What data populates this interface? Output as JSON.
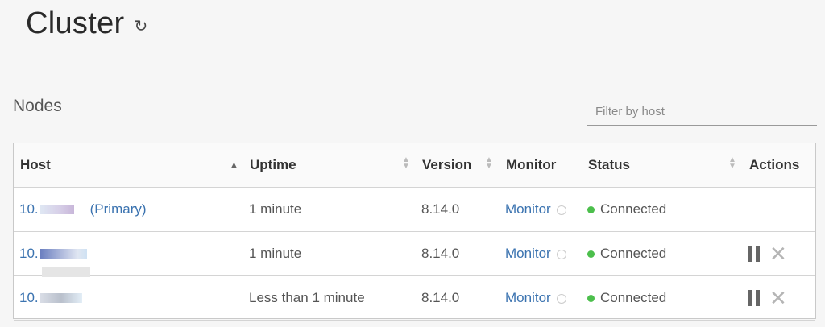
{
  "header": {
    "title": "Cluster",
    "refresh_icon": "↻"
  },
  "section": {
    "title": "Nodes"
  },
  "filter": {
    "placeholder": "Filter by host",
    "value": ""
  },
  "table": {
    "columns": {
      "host": "Host",
      "uptime": "Uptime",
      "version": "Version",
      "monitor": "Monitor",
      "status": "Status",
      "actions": "Actions"
    },
    "rows": [
      {
        "host_prefix": "10.",
        "host_suffix": "(Primary)",
        "uptime": "1 minute",
        "version": "8.14.0",
        "monitor": "Monitor",
        "status": "Connected"
      },
      {
        "host_prefix": "10.",
        "uptime": "1 minute",
        "version": "8.14.0",
        "monitor": "Monitor",
        "status": "Connected"
      },
      {
        "host_prefix": "10.",
        "uptime": "Less than 1 minute",
        "version": "8.14.0",
        "monitor": "Monitor",
        "status": "Connected"
      }
    ]
  },
  "colors": {
    "link": "#3b73b0",
    "status_connected": "#4cbf4c"
  },
  "icons": {
    "refresh": "refresh-icon",
    "sort": "sort-icon",
    "sort_ascending": "sort-ascending-icon",
    "external": "external-link-icon",
    "pause": "pause-icon",
    "close": "close-icon"
  }
}
